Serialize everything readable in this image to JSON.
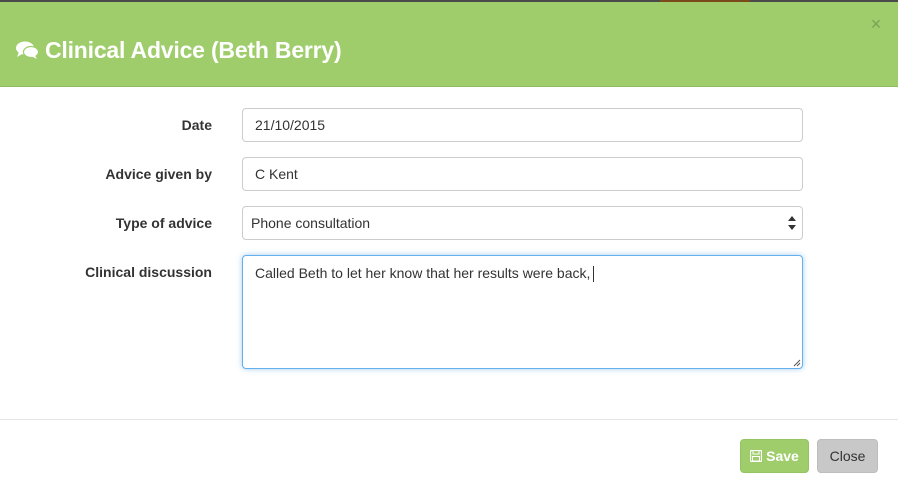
{
  "modal": {
    "title": "Clinical Advice (Beth Berry)",
    "title_icon": "comments-icon",
    "close_symbol": "×"
  },
  "form": {
    "date": {
      "label": "Date",
      "value": "21/10/2015"
    },
    "advice_given_by": {
      "label": "Advice given by",
      "value": "C Kent"
    },
    "type_of_advice": {
      "label": "Type of advice",
      "selected": "Phone consultation"
    },
    "clinical_discussion": {
      "label": "Clinical discussion",
      "value": "Called Beth to let her know that her results were back,"
    }
  },
  "footer": {
    "save_label": "Save",
    "close_label": "Close"
  },
  "colors": {
    "header": "#9fcd6c",
    "save_button": "#9fcd6c",
    "close_button": "#c8c8c8",
    "focus_border": "#66afe9"
  }
}
